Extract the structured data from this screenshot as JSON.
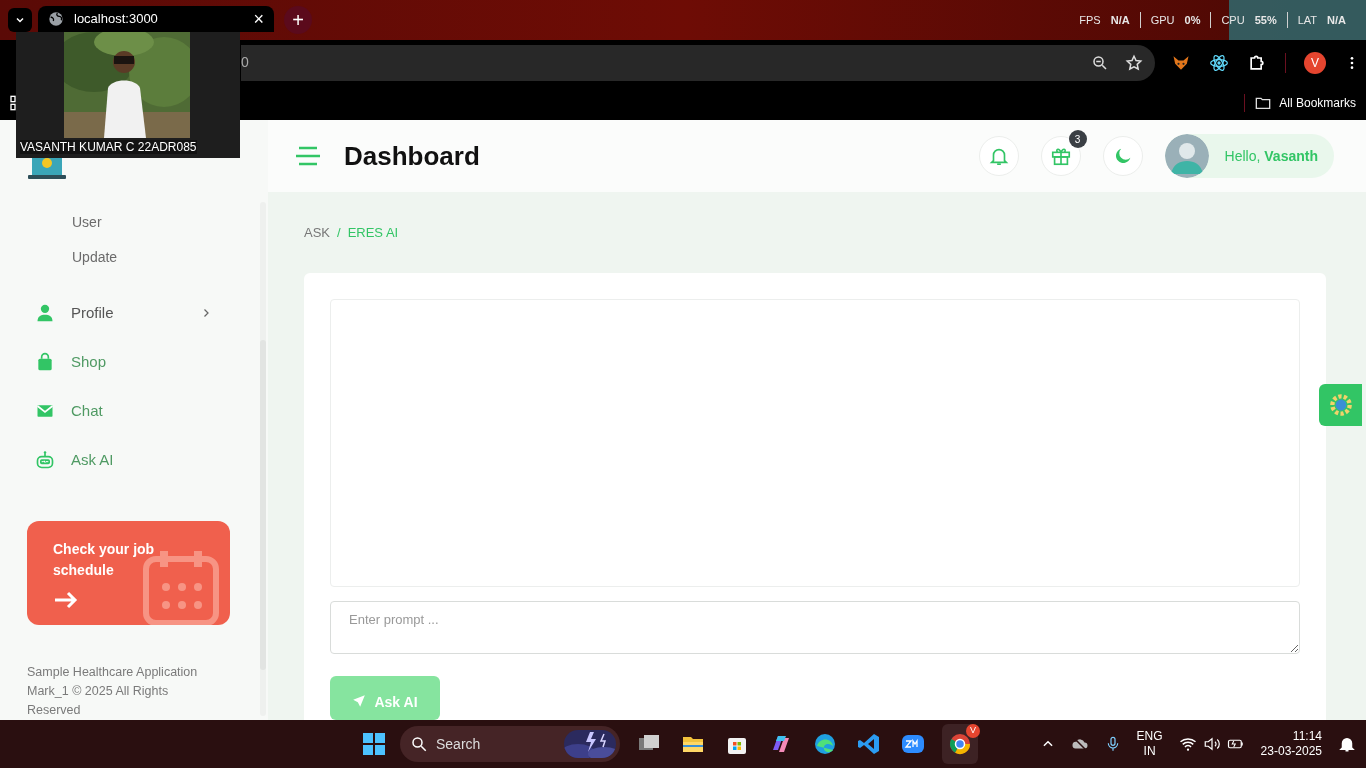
{
  "browser": {
    "tab": {
      "title": "localhost:3000",
      "close": "×",
      "new_tab": "+"
    },
    "perf_overlay": [
      {
        "label": "FPS",
        "value": "N/A"
      },
      {
        "label": "GPU",
        "value": "0%"
      },
      {
        "label": "CPU",
        "value": "55%"
      },
      {
        "label": "LAT",
        "value": "N/A"
      }
    ],
    "address": {
      "value": "0"
    },
    "profile_initial": "V",
    "bookmarks": "All Bookmarks"
  },
  "video_tile": {
    "kind": "picture",
    "caption": "VASANTH KUMAR C 22ADR085"
  },
  "sidebar": {
    "items": [
      {
        "label": "User",
        "kind": "sub"
      },
      {
        "label": "Update",
        "kind": "sub"
      },
      {
        "label": "Profile",
        "kind": "group"
      },
      {
        "label": "Shop",
        "kind": "link"
      },
      {
        "label": "Chat",
        "kind": "link"
      },
      {
        "label": "Ask AI",
        "kind": "link"
      }
    ],
    "promo": {
      "text": "Check your job schedule"
    },
    "footer": "Sample Healthcare Application Mark_1 © 2025 All Rights Reserved"
  },
  "header": {
    "title": "Dashboard",
    "gift_badge": "3",
    "greeting": "Hello, **Vasanth**"
  },
  "breadcrumb": {
    "items": [
      "ASK",
      "ERES AI"
    ],
    "separator": "/"
  },
  "ask": {
    "placeholder": "Enter prompt ...",
    "button": "Ask AI"
  },
  "taskbar": {
    "search": "Search",
    "language": [
      "ENG",
      "IN"
    ],
    "time": "11:14",
    "date": "23-03-2025",
    "chrome_badge": "V"
  }
}
